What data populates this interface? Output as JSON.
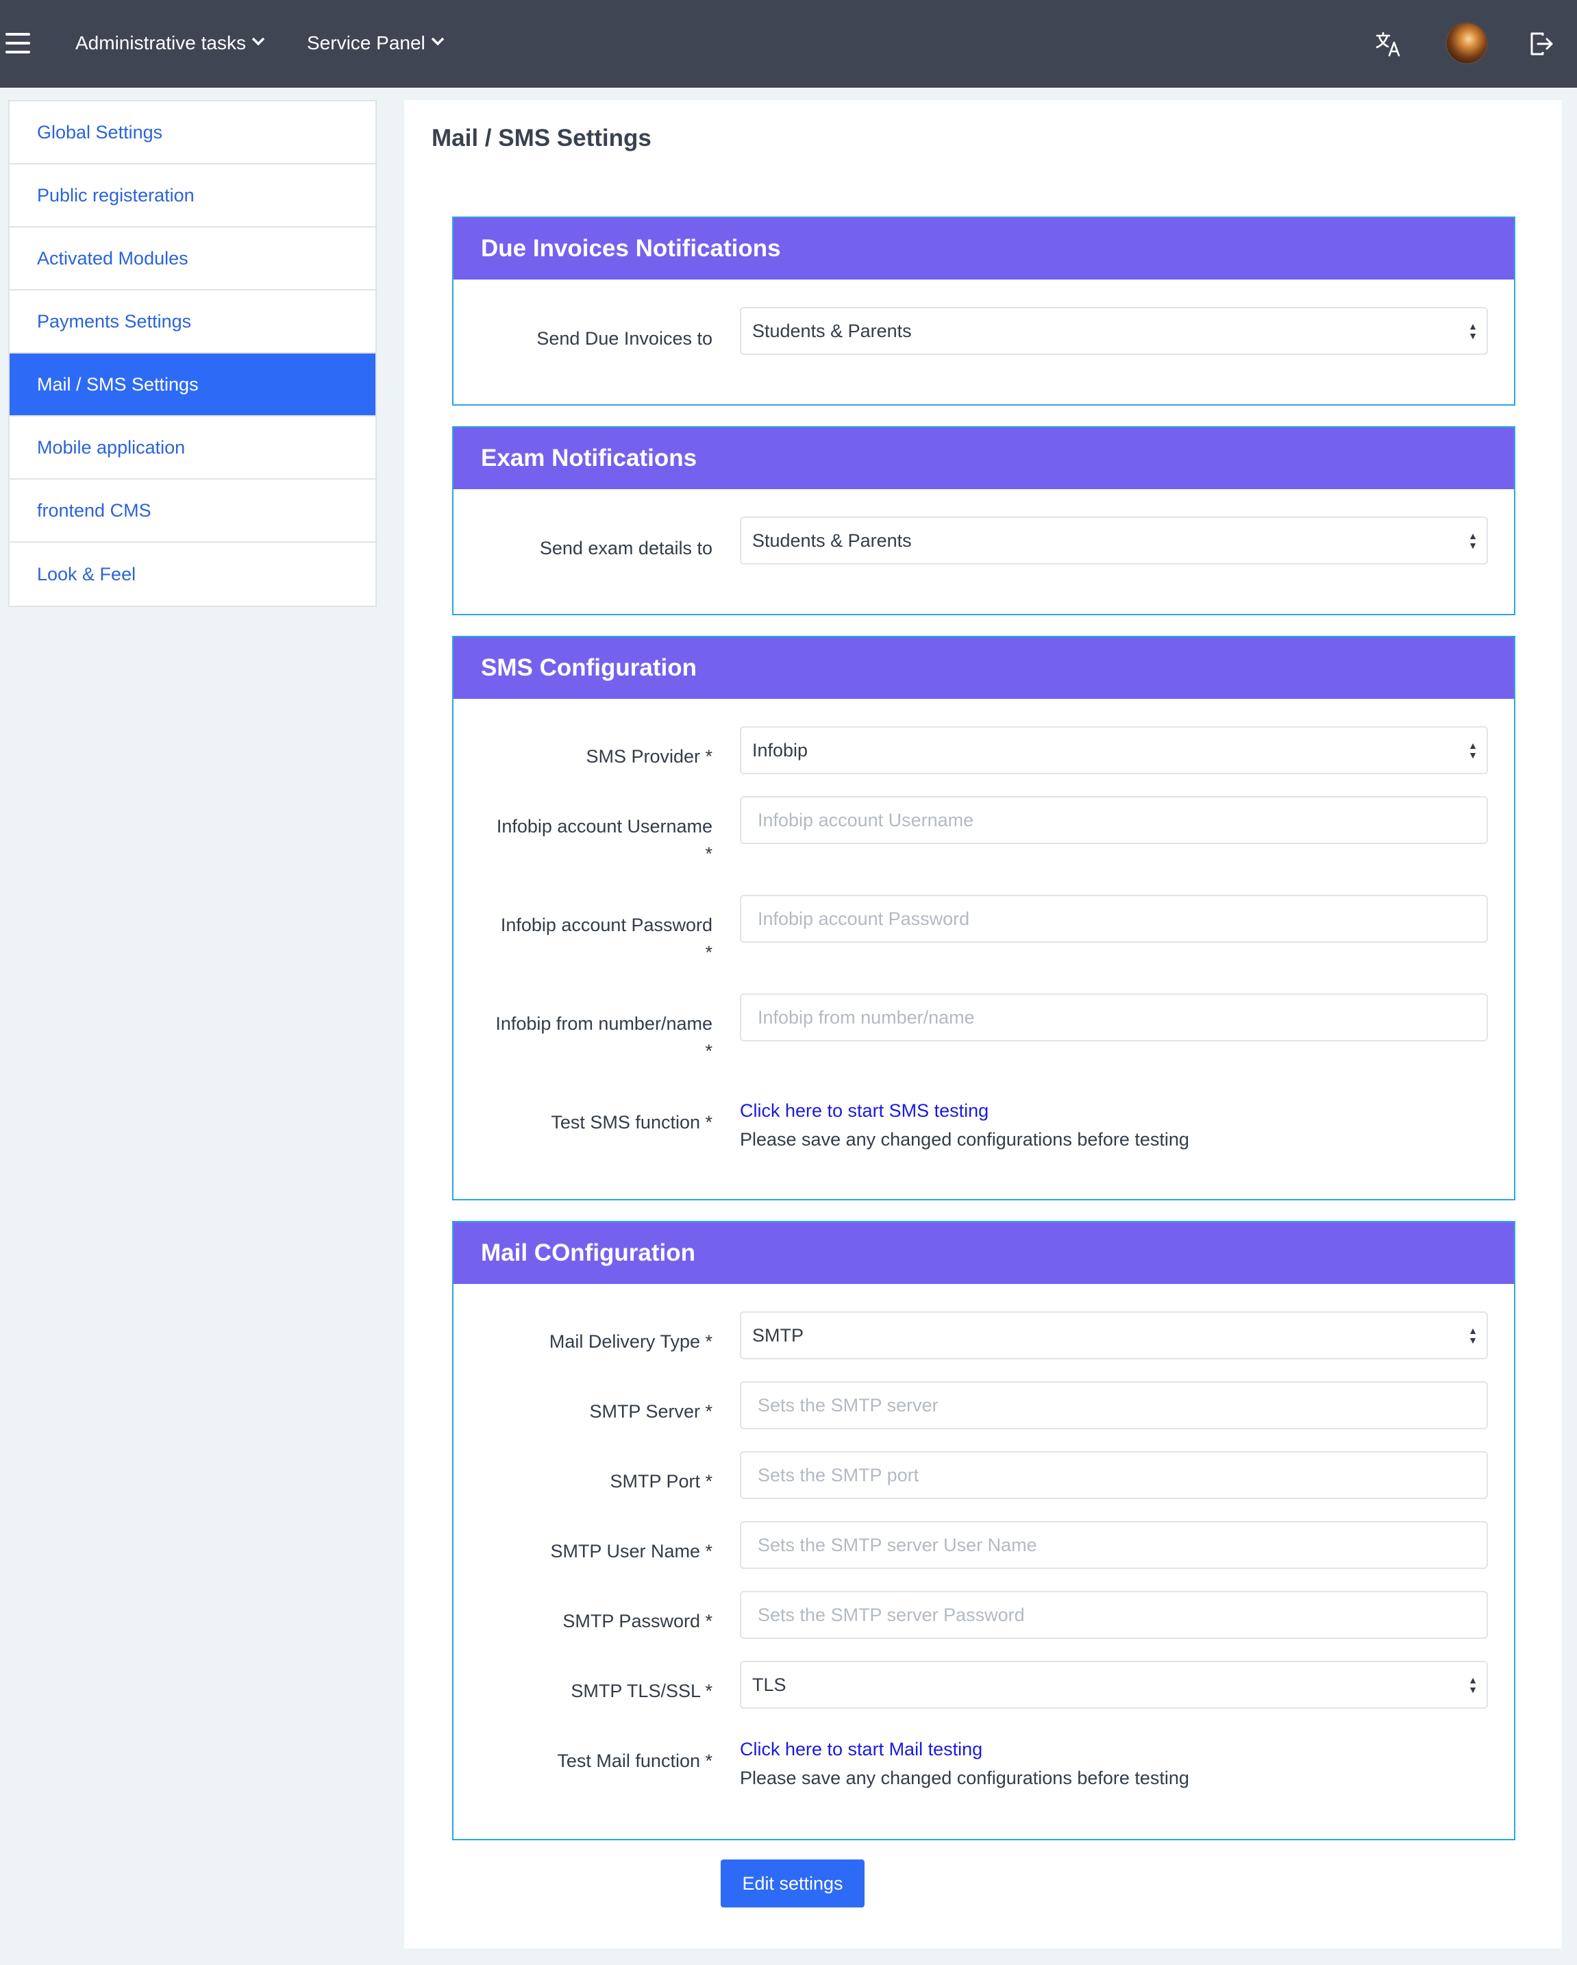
{
  "navbar": {
    "menu_1": "Administrative tasks",
    "menu_2": "Service Panel"
  },
  "sidebar": {
    "items": [
      {
        "label": "Global Settings"
      },
      {
        "label": "Public registeration"
      },
      {
        "label": "Activated Modules"
      },
      {
        "label": "Payments Settings"
      },
      {
        "label": "Mail / SMS Settings",
        "active": true
      },
      {
        "label": "Mobile application"
      },
      {
        "label": "frontend CMS"
      },
      {
        "label": "Look & Feel"
      }
    ]
  },
  "page": {
    "title": "Mail / SMS Settings"
  },
  "due_invoices": {
    "header": "Due Invoices Notifications",
    "send_label": "Send Due Invoices to",
    "send_value": "Students & Parents"
  },
  "exam": {
    "header": "Exam Notifications",
    "send_label": "Send exam details to",
    "send_value": "Students & Parents"
  },
  "sms": {
    "header": "SMS Configuration",
    "provider_label": "SMS Provider *",
    "provider_value": "Infobip",
    "username_label": "Infobip account Username",
    "username_star": "*",
    "username_placeholder": "Infobip account Username",
    "password_label": "Infobip account Password",
    "password_star": "*",
    "password_placeholder": "Infobip account Password",
    "from_label": "Infobip from number/name",
    "from_star": "*",
    "from_placeholder": "Infobip from number/name",
    "test_label": "Test SMS function *",
    "test_link": "Click here to start SMS testing",
    "test_note": "Please save any changed configurations before testing"
  },
  "mail": {
    "header": "Mail COnfiguration",
    "delivery_label": "Mail Delivery Type *",
    "delivery_value": "SMTP",
    "server_label": "SMTP Server *",
    "server_placeholder": "Sets the SMTP server",
    "port_label": "SMTP Port *",
    "port_placeholder": "Sets the SMTP port",
    "user_label": "SMTP User Name *",
    "user_placeholder": "Sets the SMTP server User Name",
    "password_label": "SMTP Password *",
    "password_placeholder": "Sets the SMTP server Password",
    "tls_label": "SMTP TLS/SSL *",
    "tls_value": "TLS",
    "test_label": "Test Mail function *",
    "test_link": "Click here to start Mail testing",
    "test_note": "Please save any changed configurations before testing"
  },
  "actions": {
    "edit_label": "Edit settings"
  },
  "colors": {
    "navbar": "#404553",
    "card_header": "#7462ee",
    "card_border": "#27a8e0",
    "primary": "#2d6bf6",
    "link": "#1a1ae0"
  },
  "icons": {
    "menu": "hamburger-icon",
    "translate": "translate-icon",
    "logout": "logout-icon"
  }
}
